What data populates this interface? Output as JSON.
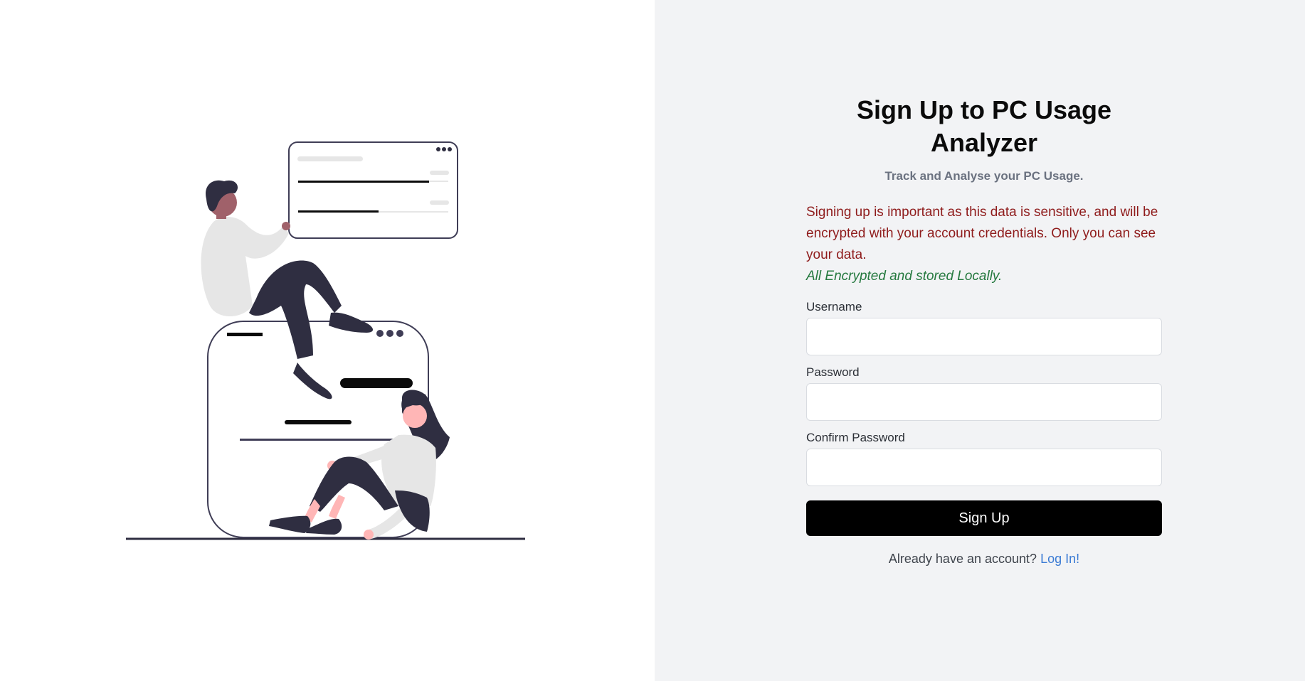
{
  "signup": {
    "title": "Sign Up to PC Usage Analyzer",
    "subtitle": "Track and Analyse your PC Usage.",
    "notice": "Signing up is important as this data is sensitive, and will be encrypted with your account credentials. Only you can see your data.",
    "notice_secure": "All Encrypted and stored Locally.",
    "username_label": "Username",
    "username_value": "",
    "password_label": "Password",
    "password_value": "",
    "confirm_label": "Confirm Password",
    "confirm_value": "",
    "submit_label": "Sign Up",
    "login_prompt": "Already have an account?",
    "login_link": "Log In!"
  },
  "colors": {
    "left_bg": "#ffffff",
    "right_bg": "#f2f3f5",
    "button_bg": "#000000",
    "notice": "#8f1c1c",
    "secure": "#25793f",
    "link": "#3b7bd4",
    "illustration_dark": "#2f2e41",
    "illustration_skin": "#a0616a",
    "illustration_pink": "#ffb6b6"
  },
  "illustration": {
    "icon": "people-with-browser-windows-illustration"
  }
}
